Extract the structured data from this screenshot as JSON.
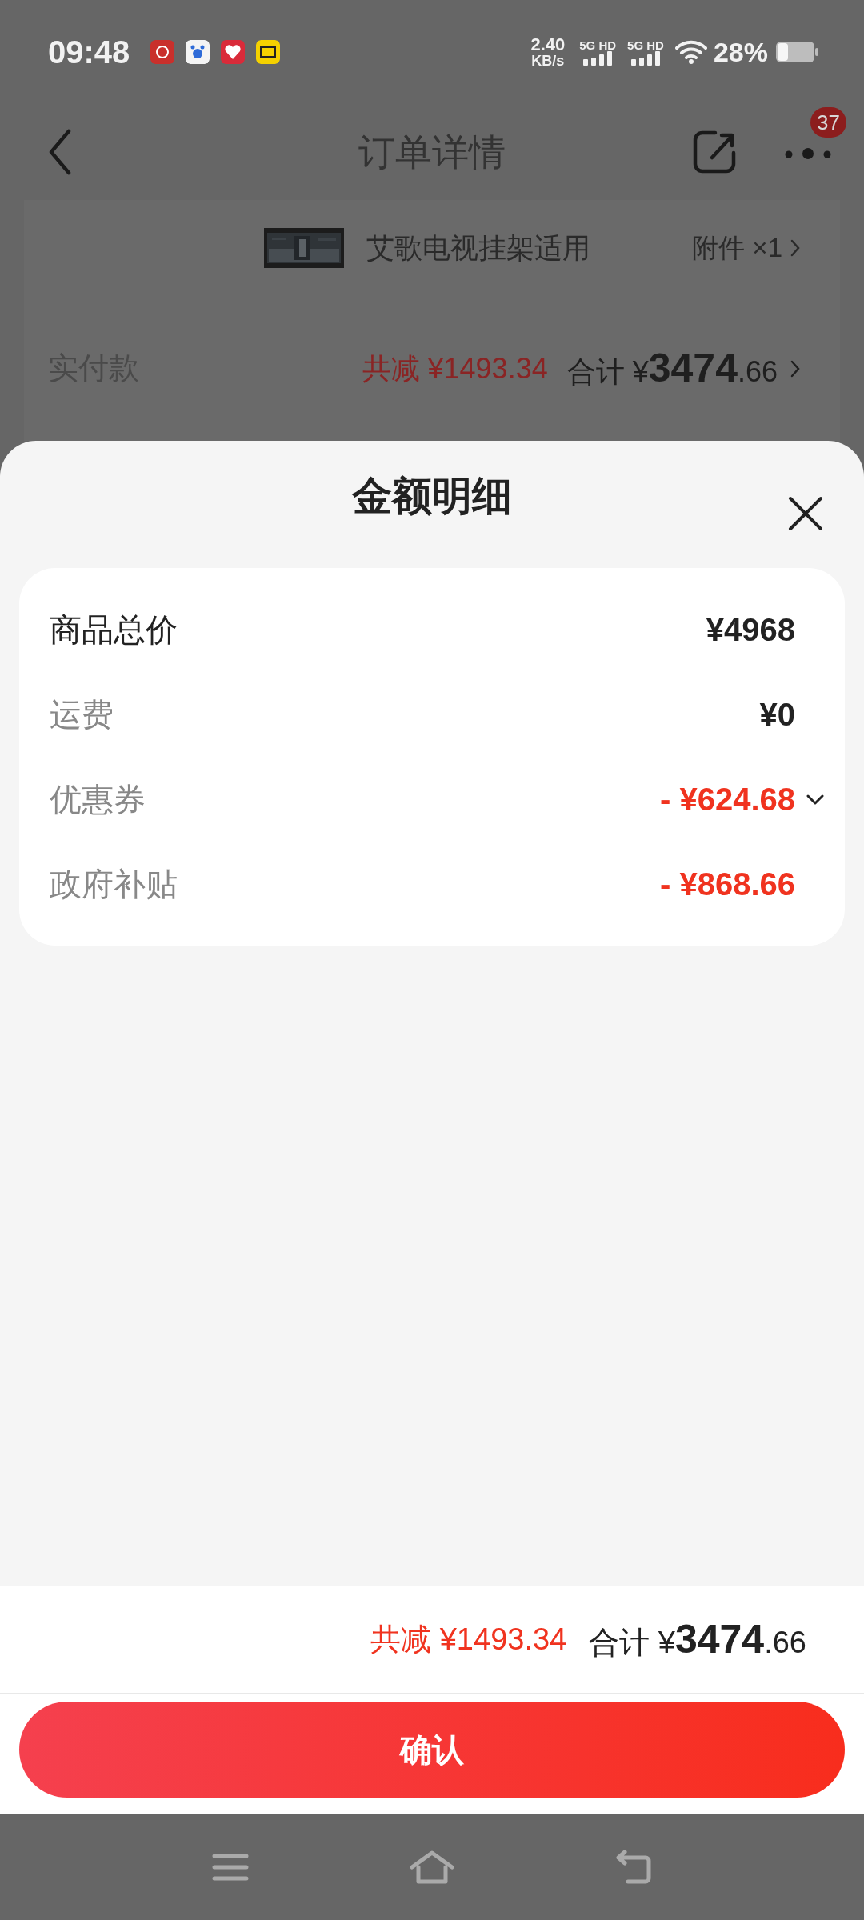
{
  "status_bar": {
    "time": "09:48",
    "net_speed": "2.40",
    "net_unit": "KB/s",
    "sims": [
      {
        "label": "5G HD"
      },
      {
        "label": "5G HD"
      }
    ],
    "battery": "28%"
  },
  "header": {
    "title": "订单详情",
    "badge": "37"
  },
  "order": {
    "product": {
      "name": "艾歌电视挂架适用",
      "extra": "附件 ×1"
    },
    "paid": {
      "label": "实付款",
      "reduced": "共减 ¥1493.34",
      "total": "合计 ¥**3474**.66"
    }
  },
  "sheet": {
    "title": "金额明细",
    "rows": [
      {
        "label": "商品总价",
        "value": "¥4968",
        "kind": "base",
        "dropdown": false
      },
      {
        "label": "运费",
        "value": "¥0",
        "kind": "fee",
        "dropdown": false
      },
      {
        "label": "优惠券",
        "value": "- ¥624.68",
        "kind": "discount",
        "dropdown": true
      },
      {
        "label": "政府补贴",
        "value": "- ¥868.66",
        "kind": "discount",
        "dropdown": false
      }
    ],
    "reduced": "共减 ¥1493.34",
    "total": "合计 ¥**3474**.66",
    "confirm": "确认"
  }
}
